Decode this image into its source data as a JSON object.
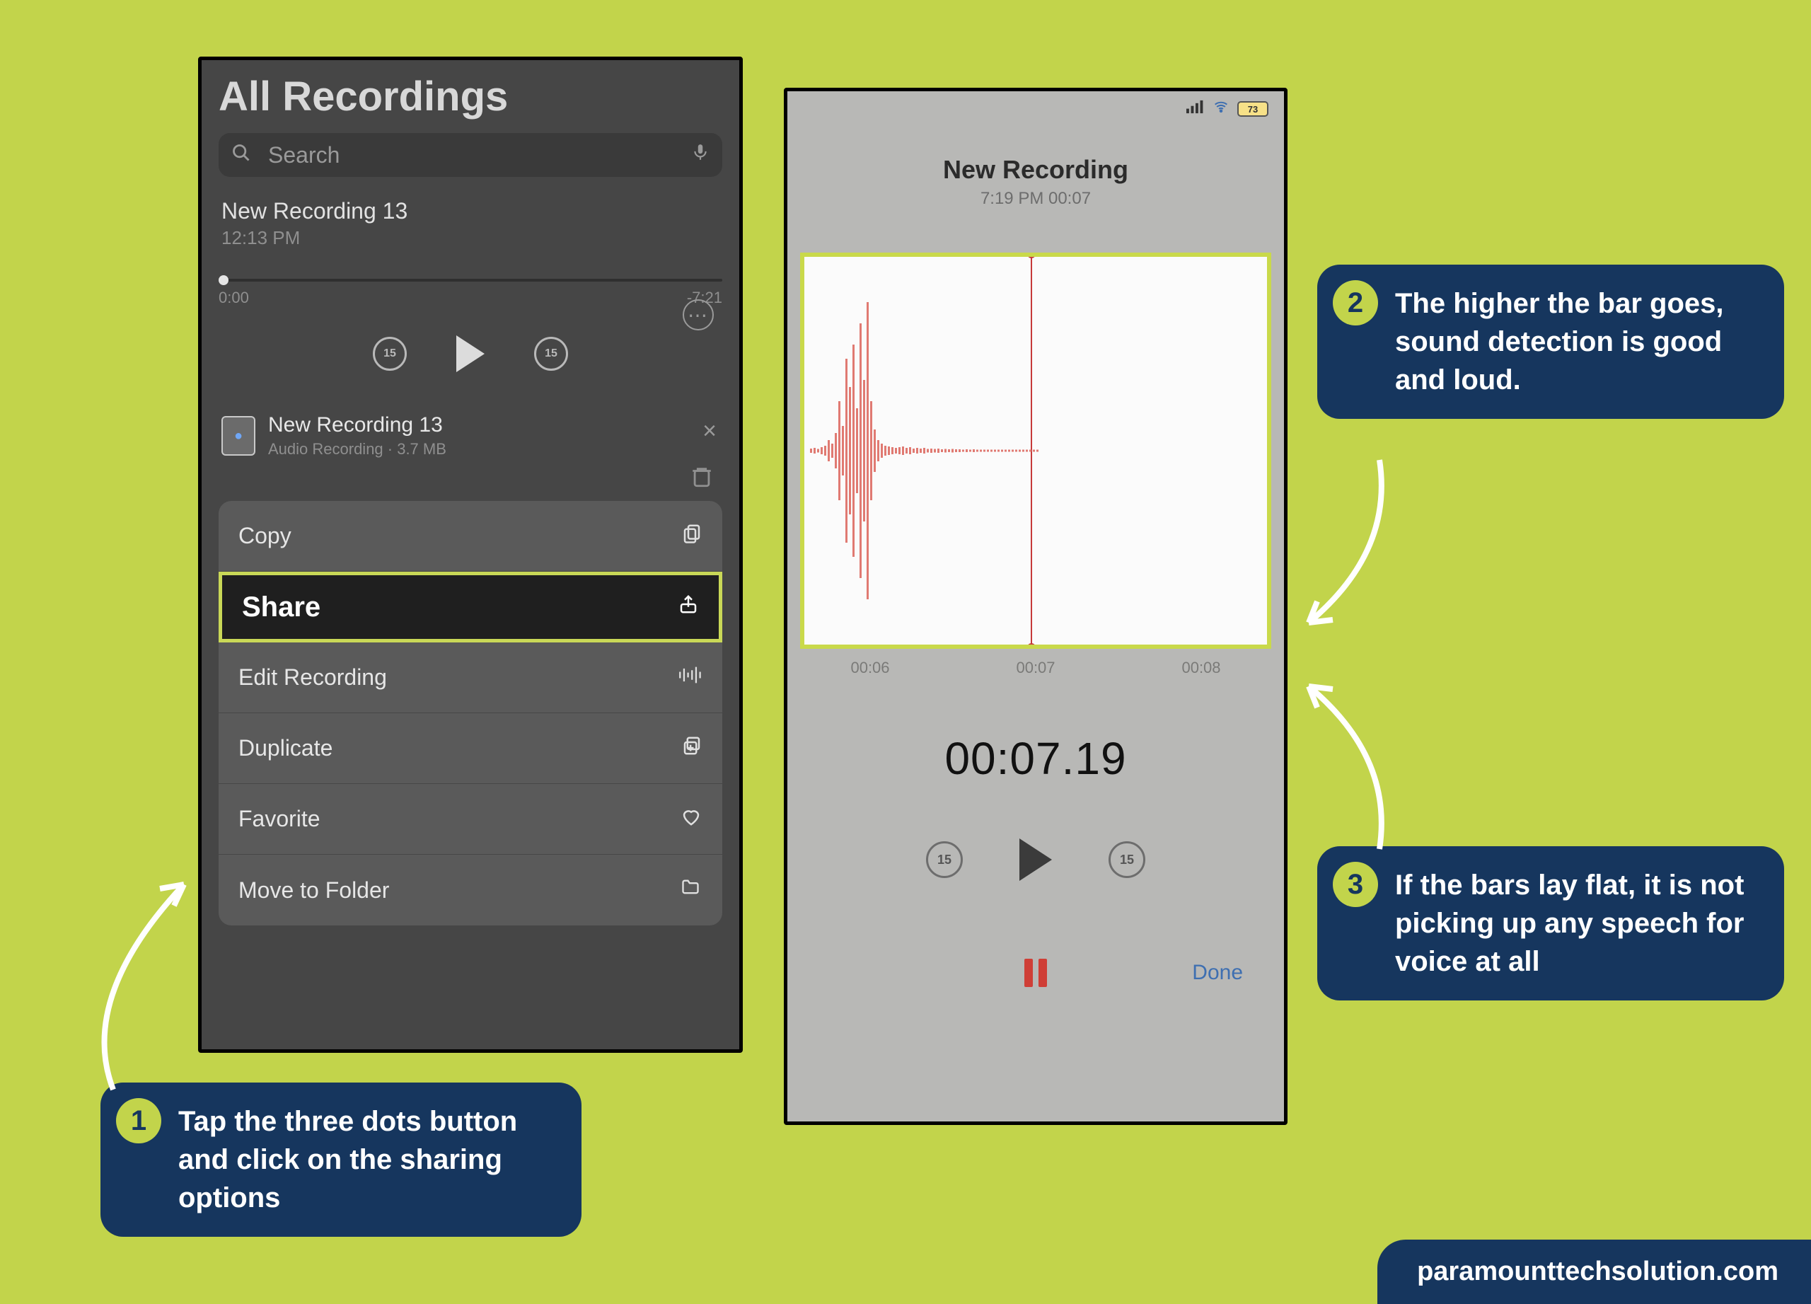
{
  "phone1": {
    "title": "All Recordings",
    "search_placeholder": "Search",
    "item": {
      "name": "New Recording 13",
      "time": "12:13 PM",
      "start": "0:00",
      "end": "-7:21"
    },
    "skip_label": "15",
    "file": {
      "name": "New Recording 13",
      "meta": "Audio Recording · 3.7 MB"
    },
    "menu": {
      "copy": "Copy",
      "share": "Share",
      "edit": "Edit Recording",
      "duplicate": "Duplicate",
      "favorite": "Favorite",
      "move": "Move to Folder"
    }
  },
  "phone2": {
    "title": "New Recording",
    "sub": "7:19 PM  00:07",
    "battery": "73",
    "ticks": {
      "a": "00:06",
      "b": "00:07",
      "c": "00:08"
    },
    "bigtime": "00:07.19",
    "skip_label": "15",
    "done": "Done"
  },
  "callouts": {
    "c1": {
      "num": "1",
      "text": "Tap the three dots button and click on the sharing options"
    },
    "c2": {
      "num": "2",
      "text": "The higher the bar goes, sound detection is good and loud."
    },
    "c3": {
      "num": "3",
      "text": "If the bars lay flat, it is not picking up any speech for voice at all"
    }
  },
  "footer": "paramounttechsolution.com"
}
